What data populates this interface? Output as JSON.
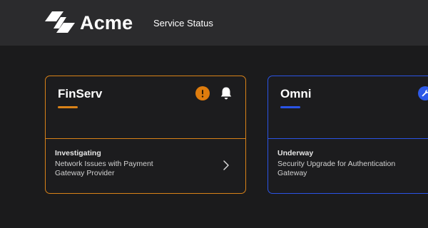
{
  "header": {
    "brand": "Acme",
    "nav_link": "Service Status",
    "logo_icon": "acme-logo-icon"
  },
  "cards": [
    {
      "title": "FinServ",
      "accent_color": "#d98218",
      "status": "Investigating",
      "description": "Network Issues with Payment Gateway Provider",
      "status_icon": "warning-icon",
      "actions": [
        "bell-icon",
        "chevron-right-icon"
      ]
    },
    {
      "title": "Omni",
      "accent_color": "#2a54e6",
      "status": "Underway",
      "description": "Security Upgrade for Authentication Gateway",
      "status_icon": "wrench-icon"
    }
  ]
}
